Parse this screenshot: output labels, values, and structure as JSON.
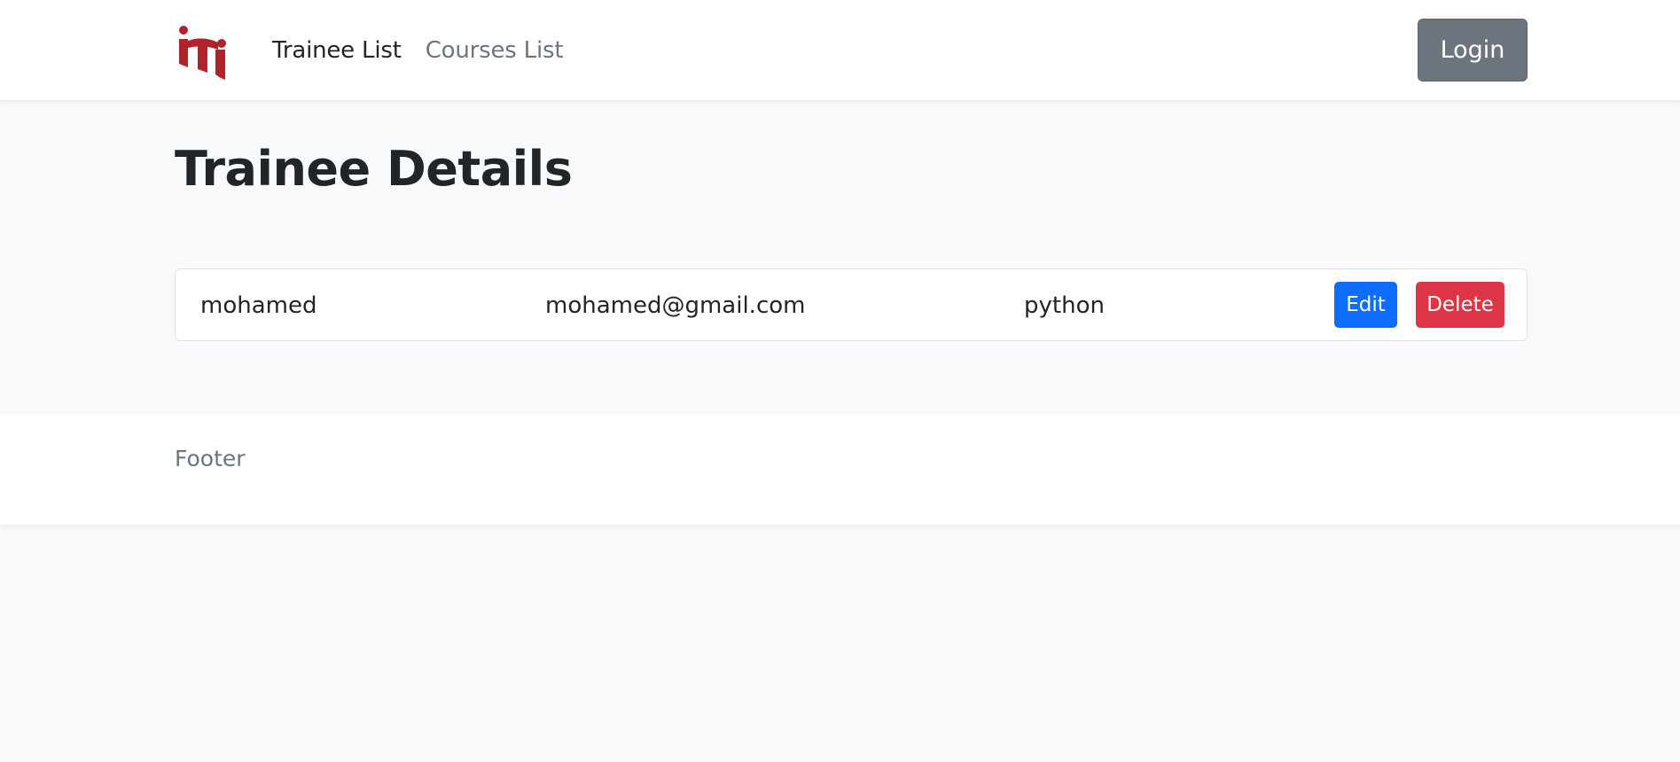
{
  "navbar": {
    "logo_text": "iti",
    "links": [
      {
        "label": "Trainee List",
        "active": true
      },
      {
        "label": "Courses List",
        "active": false
      }
    ],
    "login_label": "Login"
  },
  "main": {
    "title": "Trainee Details",
    "trainee": {
      "name": "mohamed",
      "email": "mohamed@gmail.com",
      "course": "python"
    },
    "actions": {
      "edit_label": "Edit",
      "delete_label": "Delete"
    }
  },
  "footer": {
    "text": "Footer"
  },
  "colors": {
    "brand": "#b0232a",
    "primary": "#0d6efd",
    "danger": "#dc3545",
    "secondary": "#6c757d",
    "background": "#f8f9fa"
  }
}
